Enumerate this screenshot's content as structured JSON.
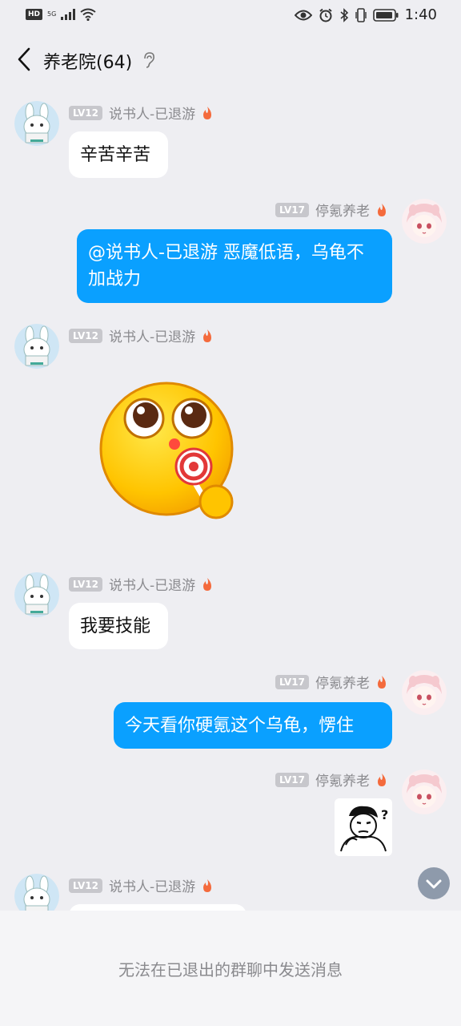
{
  "status_bar": {
    "hd": "HD",
    "network": "5G",
    "time": "1:40"
  },
  "header": {
    "title": "养老院(64)"
  },
  "messages": [
    {
      "side": "in",
      "level": "LV12",
      "sender": "说书人-已退游",
      "text": "辛苦辛苦"
    },
    {
      "side": "out",
      "level": "LV17",
      "sender": "停氪养老",
      "text": "@说书人-已退游 恶魔低语，乌龟不加战力"
    },
    {
      "side": "in",
      "level": "LV12",
      "sender": "说书人-已退游",
      "sticker": "lollipop-emoji-sticker"
    },
    {
      "side": "in",
      "level": "LV12",
      "sender": "说书人-已退游",
      "text": "我要技能"
    },
    {
      "side": "out",
      "level": "LV17",
      "sender": "停氪养老",
      "text": "今天看你硬氪这个乌龟，愣住"
    },
    {
      "side": "out",
      "level": "LV17",
      "sender": "停氪养老",
      "sticker": "confused-man-meme-sticker"
    },
    {
      "side": "in",
      "level": "LV12",
      "sender": "说书人-已退游",
      "text": ""
    }
  ],
  "footer": {
    "notice": "无法在已退出的群聊中发送消息"
  },
  "colors": {
    "outgoing_bubble": "#0aa0ff",
    "incoming_bubble": "#ffffff",
    "background": "#eeeef2"
  }
}
